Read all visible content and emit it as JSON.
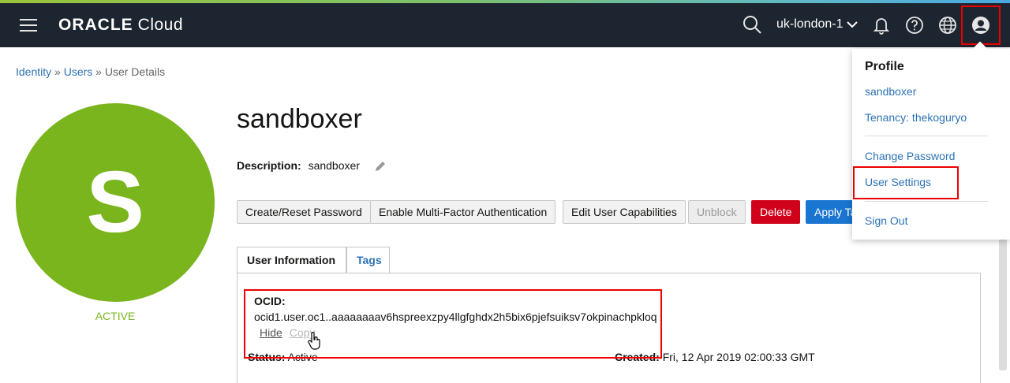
{
  "header": {
    "logo_brand": "ORACLE",
    "logo_product": "Cloud",
    "region": "uk-london-1",
    "icons": [
      "menu-icon",
      "search-icon",
      "bell-icon",
      "help-icon",
      "globe-icon",
      "user-icon"
    ]
  },
  "breadcrumb": {
    "identity": "Identity",
    "sep1": "»",
    "users": "Users",
    "sep2": "»",
    "current": "User Details"
  },
  "user": {
    "avatar_letter": "S",
    "status_label": "ACTIVE",
    "name": "sandboxer",
    "description_label": "Description:",
    "description_value": "sandboxer"
  },
  "actions": {
    "create_reset_password": "Create/Reset Password",
    "enable_mfa": "Enable Multi-Factor Authentication",
    "edit_capabilities": "Edit User Capabilities",
    "unblock": "Unblock",
    "delete": "Delete",
    "apply_tag": "Apply Ta"
  },
  "tabs": {
    "user_information": "User Information",
    "tags": "Tags"
  },
  "details": {
    "ocid_label": "OCID:",
    "ocid_value": "ocid1.user.oc1..aaaaaaaav6hspreexzpy4llgfghdx2h5bix6pjefsuiksv7okpinachpkloq",
    "hide": "Hide",
    "copy": "Copy",
    "status_label": "Status:",
    "status_value": "Active",
    "created_label": "Created:",
    "created_value": "Fri, 12 Apr 2019 02:00:33 GMT"
  },
  "profile_menu": {
    "title": "Profile",
    "username": "sandboxer",
    "tenancy": "Tenancy: thekoguryo",
    "change_password": "Change Password",
    "user_settings": "User Settings",
    "sign_out": "Sign Out"
  },
  "colors": {
    "topbar": "#1d2530",
    "avatar": "#7ab51d",
    "link": "#2d72b5",
    "delete": "#d0021b",
    "primary": "#1a75d1",
    "highlight": "#e00000"
  }
}
